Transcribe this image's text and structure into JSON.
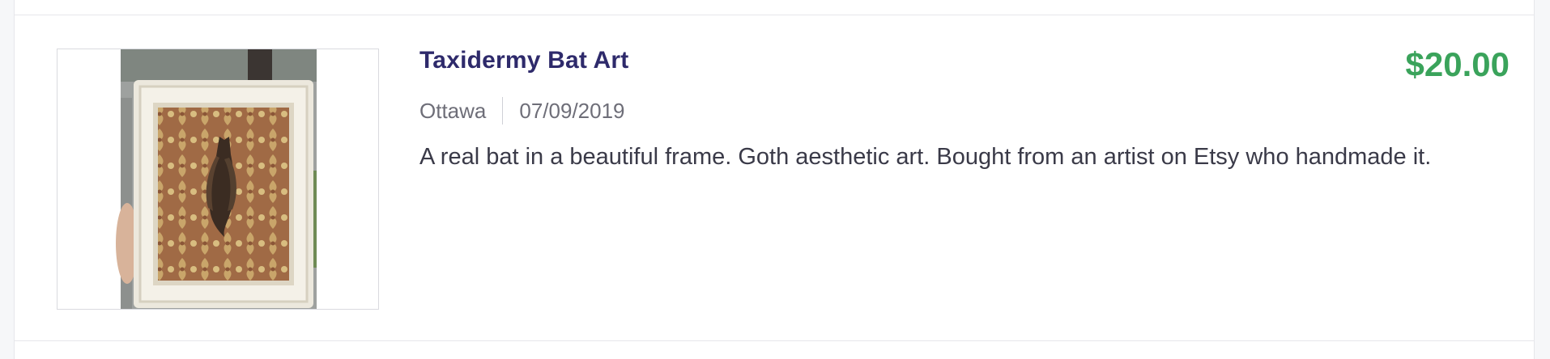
{
  "listing": {
    "title": "Taxidermy Bat Art",
    "price": "$20.00",
    "location": "Ottawa",
    "date": "07/09/2019",
    "description": "A real bat in a beautiful frame. Goth aesthetic art. Bought from an artist on Etsy who handmade it.",
    "favorite_icon": "heart-icon",
    "image_subject": "framed taxidermy bat"
  },
  "colors": {
    "title": "#2e2a6b",
    "price": "#3aa35b",
    "meta": "#6e6e78",
    "description": "#3a3a48",
    "heart": "#b9b9be"
  }
}
